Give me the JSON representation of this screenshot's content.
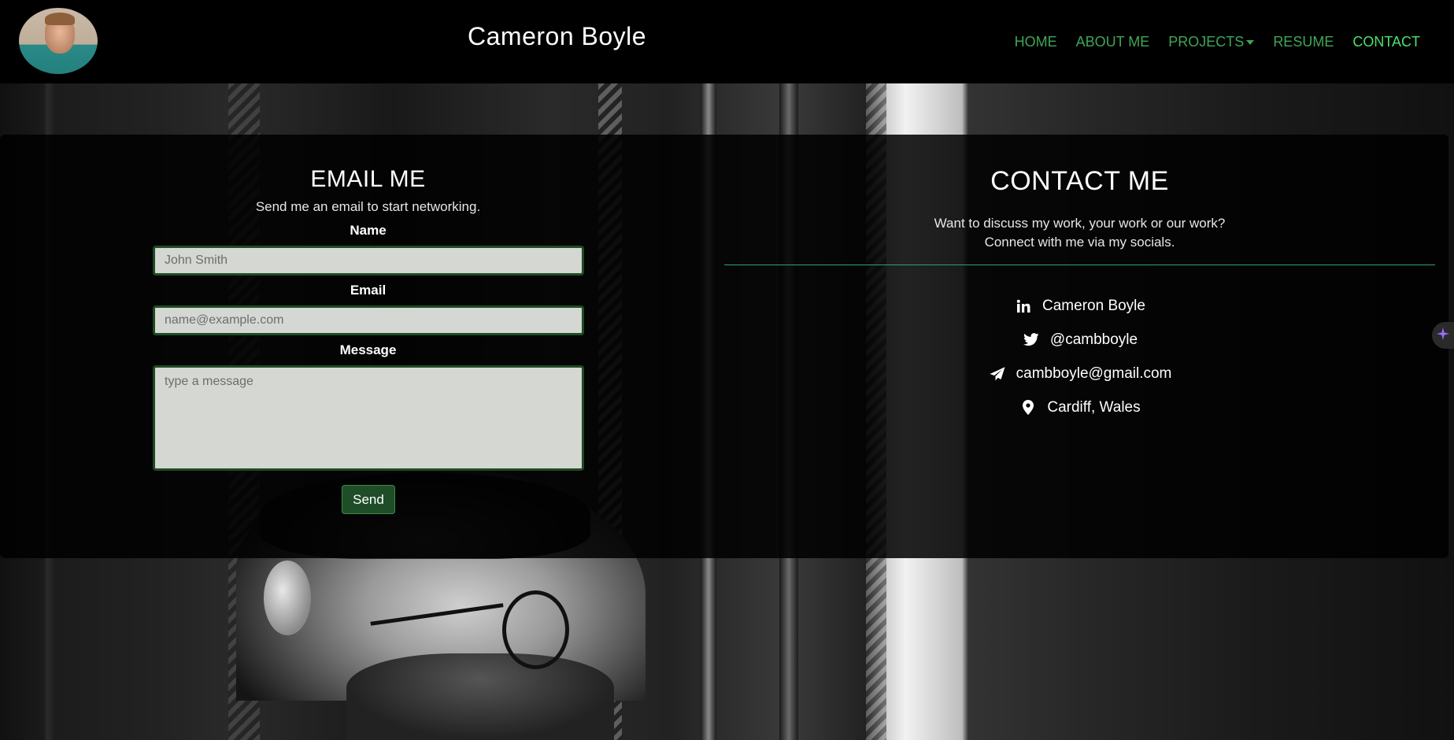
{
  "header": {
    "brand_first": "Cameron",
    "brand_last": " Boyle",
    "nav": [
      {
        "label": "HOME"
      },
      {
        "label": "ABOUT ME"
      },
      {
        "label": "PROJECTS"
      },
      {
        "label": "RESUME"
      },
      {
        "label": "CONTACT"
      }
    ],
    "active_nav": "CONTACT"
  },
  "email_form": {
    "title": "EMAIL ME",
    "subtitle": "Send me an email to start networking.",
    "name_label": "Name",
    "name_placeholder": "John Smith",
    "email_label": "Email",
    "email_placeholder": "name@example.com",
    "message_label": "Message",
    "message_placeholder": "type a message",
    "send_label": "Send"
  },
  "contact": {
    "title": "CONTACT ME",
    "line1": "Want to discuss my work, your work or our work?",
    "line2": "Connect with me via my socials.",
    "items": [
      {
        "icon": "linkedin-icon",
        "text": "Cameron Boyle"
      },
      {
        "icon": "twitter-icon",
        "text": "@cambboyle"
      },
      {
        "icon": "paper-plane-icon",
        "text": "cambboyle@gmail.com"
      },
      {
        "icon": "map-pin-icon",
        "text": "Cardiff, Wales"
      }
    ]
  },
  "colors": {
    "nav_link": "#3fa656",
    "nav_active": "#4ee06b",
    "accent_border": "#1f4b23",
    "divider": "#2fa080"
  }
}
